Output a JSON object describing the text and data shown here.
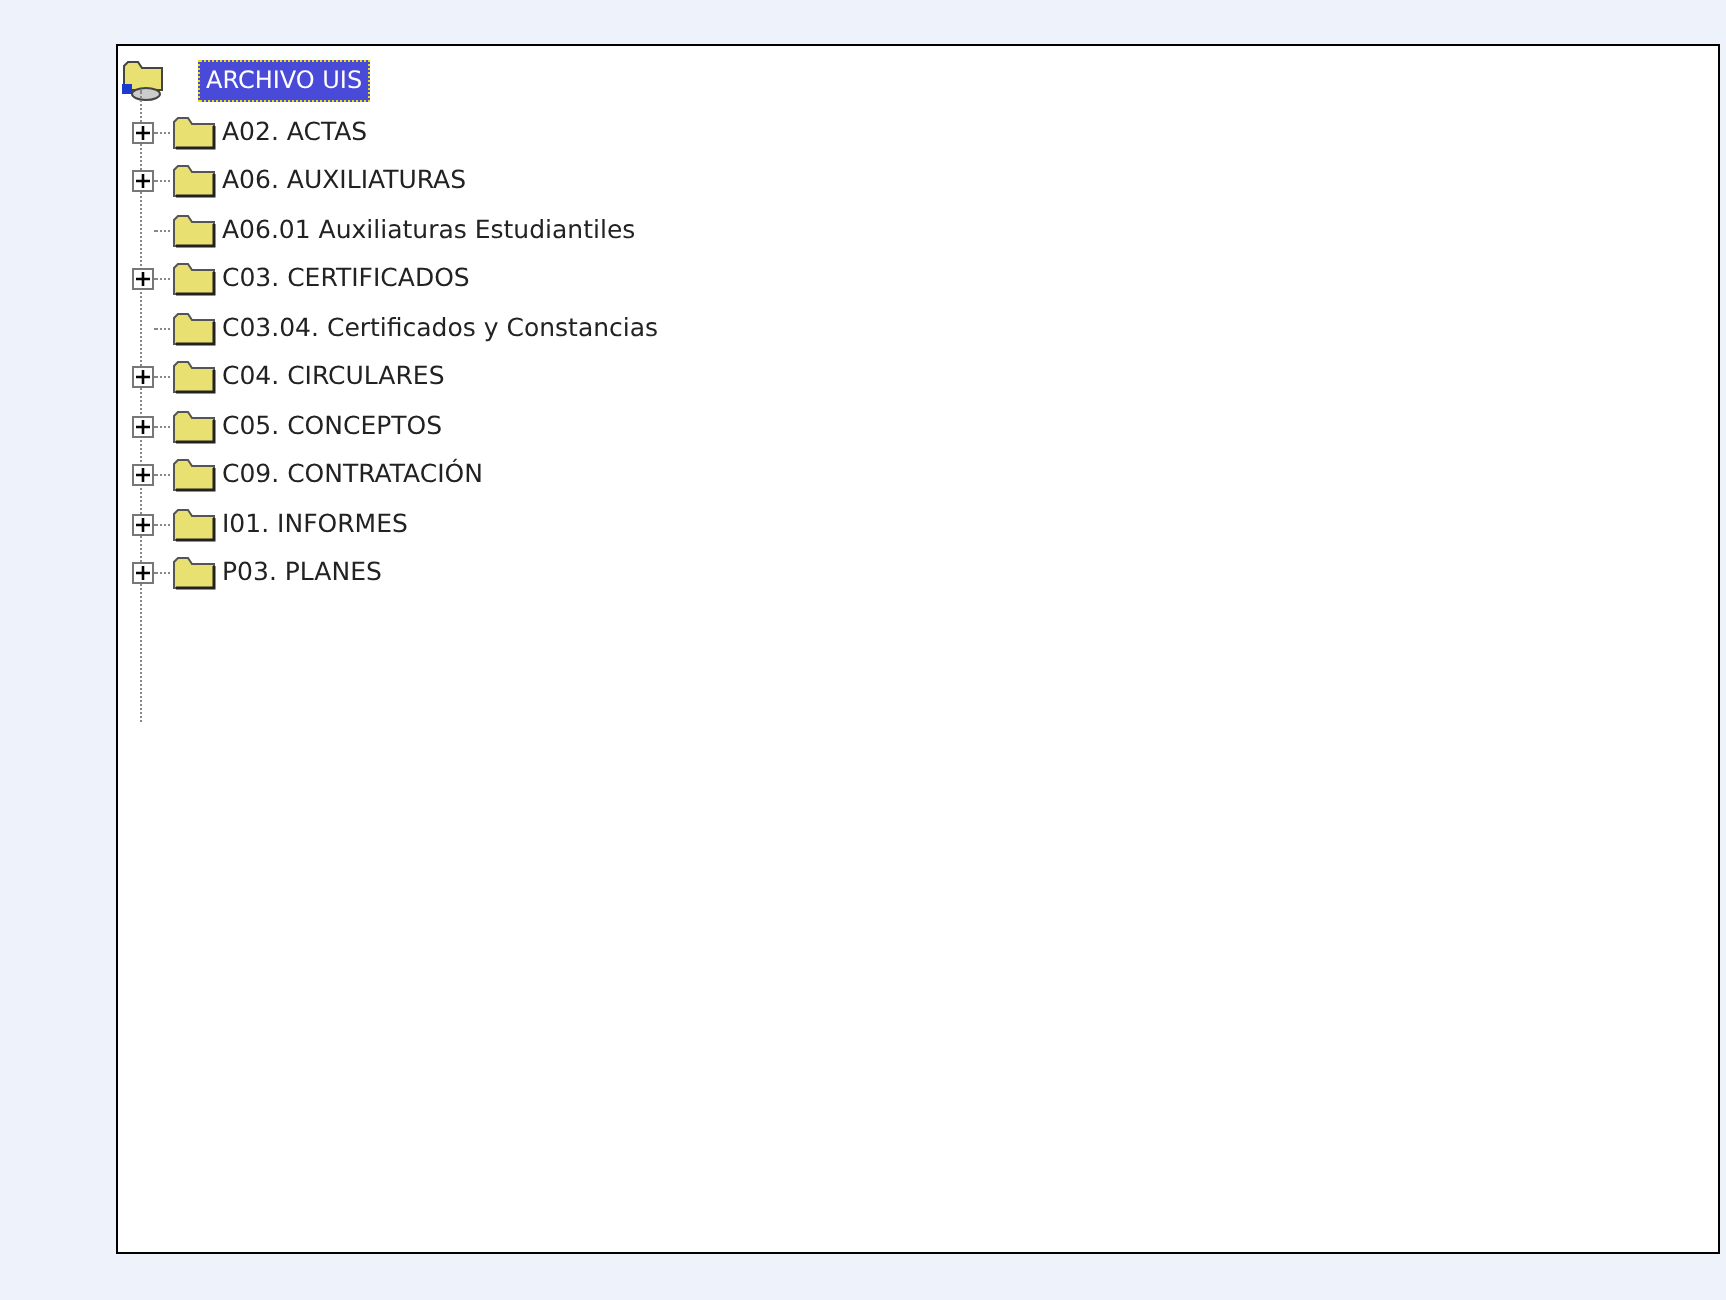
{
  "tree": {
    "root": {
      "label": "ARCHIVO UIS",
      "selected": true,
      "children": [
        {
          "label": "A02. ACTAS",
          "expandable": true
        },
        {
          "label": "A06. AUXILIATURAS",
          "expandable": true
        },
        {
          "label": "A06.01 Auxiliaturas Estudiantiles",
          "expandable": false
        },
        {
          "label": "C03. CERTIFICADOS",
          "expandable": true
        },
        {
          "label": "C03.04. Certificados y Constancias",
          "expandable": false
        },
        {
          "label": "C04. CIRCULARES",
          "expandable": true
        },
        {
          "label": "C05. CONCEPTOS",
          "expandable": true
        },
        {
          "label": "C09. CONTRATACIÓN",
          "expandable": true
        },
        {
          "label": "I01. INFORMES",
          "expandable": true
        },
        {
          "label": "P03. PLANES",
          "expandable": true
        }
      ]
    }
  }
}
